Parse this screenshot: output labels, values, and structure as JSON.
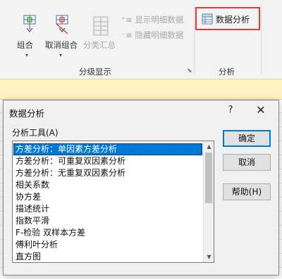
{
  "ribbon": {
    "group_label": "组合",
    "ungroup_label": "取消组合",
    "subtotal_label": "分类汇总",
    "show_detail_label": "显示明细数据",
    "hide_detail_label": "隐藏明细数据",
    "outline_group_label": "分级显示",
    "data_analysis_label": "数据分析",
    "analysis_group_label": "分析",
    "highlight_color": "#e23a3a"
  },
  "dialog": {
    "title": "数据分析",
    "help_glyph": "?",
    "close_glyph": "✕",
    "tools_label": "分析工具(A)",
    "items": [
      "方差分析：单因素方差分析",
      "方差分析：可重复双因素分析",
      "方差分析：无重复双因素分析",
      "相关系数",
      "协方差",
      "描述统计",
      "指数平滑",
      "F-检验 双样本方差",
      "傅利叶分析",
      "直方图"
    ],
    "selected_index": 0,
    "buttons": {
      "ok": "确定",
      "cancel": "取消",
      "help": "帮助(H)"
    },
    "selection_color": "#0078d7"
  }
}
